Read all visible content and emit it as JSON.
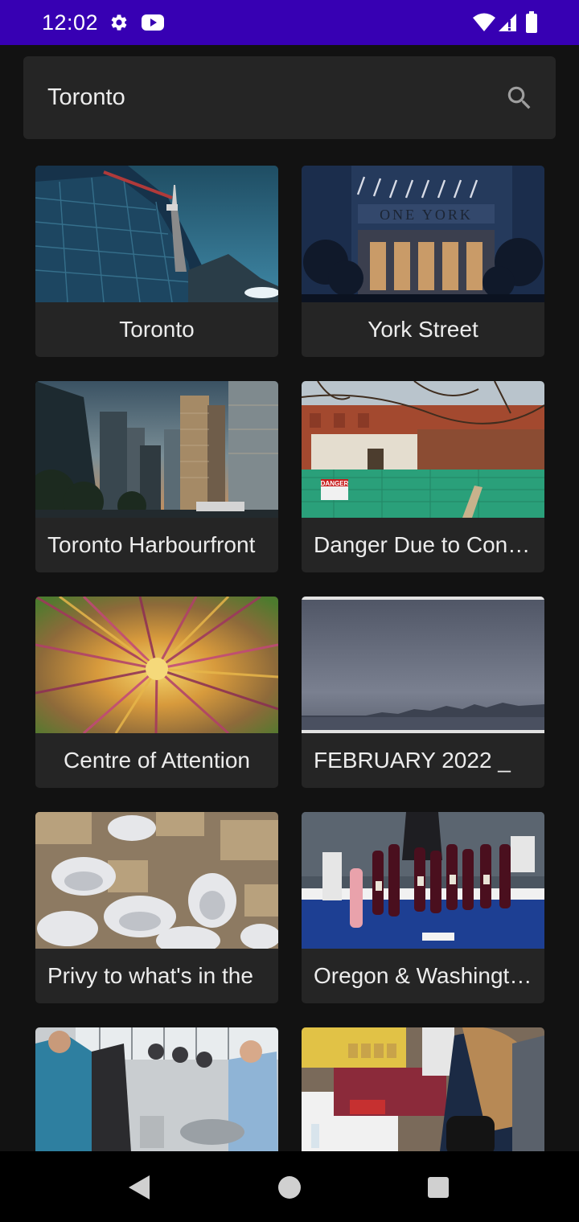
{
  "status_bar": {
    "time": "12:02",
    "icons": [
      "gear-icon",
      "youtube-icon",
      "wifi-icon",
      "signal-icon",
      "battery-icon"
    ],
    "color": "#3700b3"
  },
  "search": {
    "query": "Toronto",
    "icon": "search-icon"
  },
  "results": [
    {
      "title": "Toronto"
    },
    {
      "title": "York Street",
      "image_text": "ONE YORK"
    },
    {
      "title": "Toronto Harbourfront"
    },
    {
      "title": "Danger Due to Construction",
      "image_text": "DANGER"
    },
    {
      "title": "Centre of Attention"
    },
    {
      "title": "FEBRUARY 2022 _"
    },
    {
      "title": "Privy to what's in the"
    },
    {
      "title": "Oregon & Washington"
    },
    {
      "title": ""
    },
    {
      "title": ""
    }
  ],
  "nav_bar": {
    "icons": [
      "back-icon",
      "home-icon",
      "recents-icon"
    ]
  }
}
